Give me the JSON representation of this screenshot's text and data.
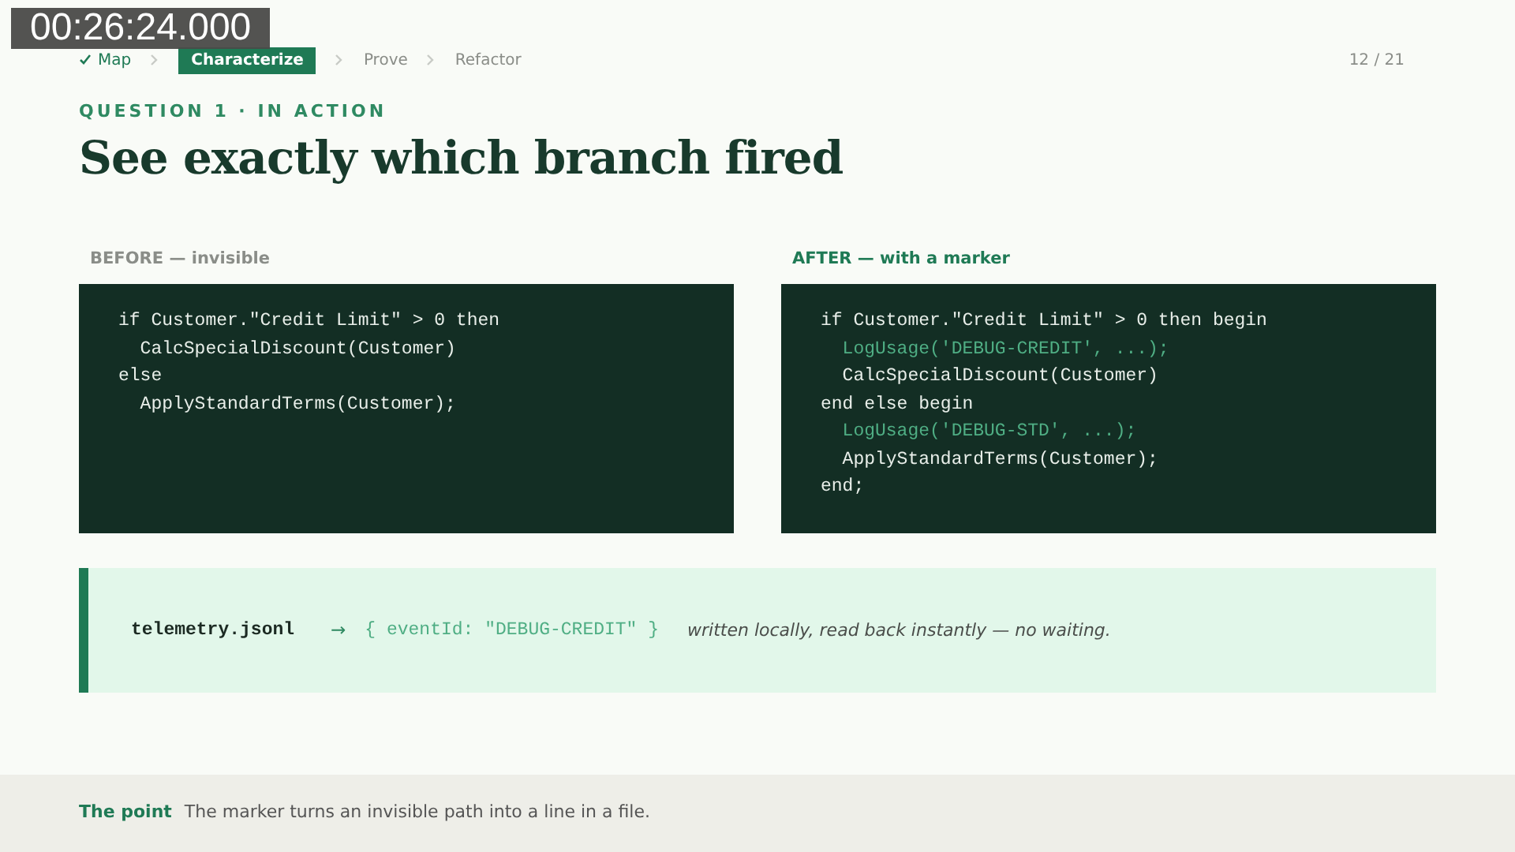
{
  "player": {
    "timestamp": "00:26:24.000"
  },
  "breadcrumb": [
    {
      "label": "Map",
      "done": true,
      "selected": false
    },
    {
      "label": "Characterize",
      "done": false,
      "selected": true
    },
    {
      "label": "Prove",
      "done": false,
      "selected": false
    },
    {
      "label": "Refactor",
      "done": false,
      "selected": false
    }
  ],
  "page_counter": "12 / 21",
  "eyebrow": "QUESTION 1 · IN ACTION",
  "title": "See exactly which branch fired",
  "panels": [
    {
      "label": "BEFORE — invisible",
      "kind": "before",
      "lines": [
        {
          "text": "if Customer.\"Credit Limit\" > 0 then",
          "kind": "code"
        },
        {
          "text": "  CalcSpecialDiscount(Customer)",
          "kind": "code"
        },
        {
          "text": "else",
          "kind": "code"
        },
        {
          "text": "  ApplyStandardTerms(Customer);",
          "kind": "code"
        }
      ]
    },
    {
      "label": "AFTER — with a marker",
      "kind": "after",
      "lines": [
        {
          "text": "if Customer.\"Credit Limit\" > 0 then begin",
          "kind": "code"
        },
        {
          "text": "  LogUsage('DEBUG-CREDIT', ...);",
          "kind": "marker"
        },
        {
          "text": "  CalcSpecialDiscount(Customer)",
          "kind": "code"
        },
        {
          "text": "end else begin",
          "kind": "code"
        },
        {
          "text": "  LogUsage('DEBUG-STD', ...);",
          "kind": "marker"
        },
        {
          "text": "  ApplyStandardTerms(Customer);",
          "kind": "code"
        },
        {
          "text": "end;",
          "kind": "code"
        }
      ]
    }
  ],
  "callout": {
    "file": "telemetry.jsonl",
    "arrow": "→",
    "json": "{ eventId: \"DEBUG-CREDIT\" }",
    "note": "written locally, read back instantly — no waiting."
  },
  "footer": {
    "label": "The point",
    "text": "The marker turns an invisible path into a line in a file."
  }
}
